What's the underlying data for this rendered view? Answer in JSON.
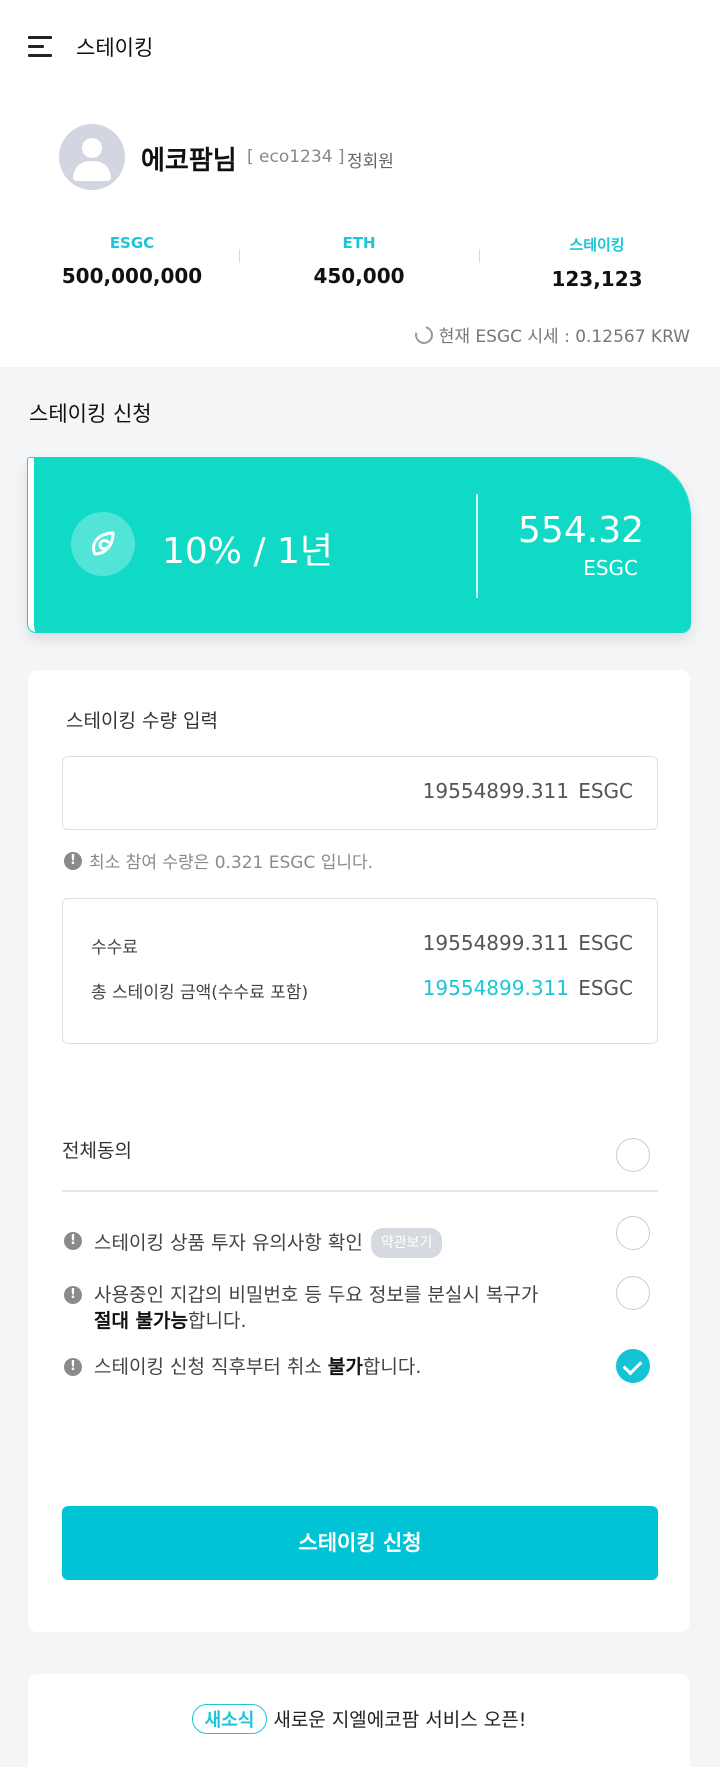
{
  "header": {
    "title": "스테이킹"
  },
  "user": {
    "name": "에코팜님",
    "id": "[ eco1234 ]",
    "grade": "정회원"
  },
  "stats": [
    {
      "label": "ESGC",
      "value": "500,000,000"
    },
    {
      "label": "ETH",
      "value": "450,000"
    },
    {
      "label": "스테이킹",
      "value": "123,123"
    }
  ],
  "price_text": "현재 ESGC 시세 : 0.12567 KRW",
  "section_title": "스테이킹 신청",
  "product": {
    "rate": "10% / 1년",
    "amount": "554.32",
    "unit": "ESGC"
  },
  "form": {
    "amount_label": "스테이킹 수량 입력",
    "amount_value": "19554899.311",
    "amount_unit": "ESGC",
    "min_note": "최소 참여 수량은 0.321 ESGC 입니다.",
    "fee_label": "수수료",
    "fee_value": "19554899.311",
    "fee_unit": "ESGC",
    "total_label": "총 스테이킹 금액(수수료 포함)",
    "total_value": "19554899.311",
    "total_unit": "ESGC"
  },
  "agreements": {
    "all_label": "전체동의",
    "all_checked": false,
    "terms": [
      {
        "text": "스테이킹 상품 투자 유의사항 확인",
        "badge": "약관보기",
        "checked": false
      },
      {
        "text_a": "사용중인 지갑의 비밀번호 등 두요 정보를 분실시 복구가",
        "text_bold": "절대 불가능",
        "text_b": "합니다.",
        "checked": false
      },
      {
        "text_a": "스테이킹 신청 직후부터 취소 ",
        "text_bold": "불가",
        "text_b": "합니다.",
        "checked": true
      }
    ]
  },
  "submit_label": "스테이킹 신청",
  "news": {
    "tag": "새소식",
    "text": "새로운 지엘에코팜 서비스 오픈!"
  },
  "colors": {
    "accent": "#1cc6d6",
    "product_card": "#10dac6",
    "button": "#00c4d6"
  }
}
